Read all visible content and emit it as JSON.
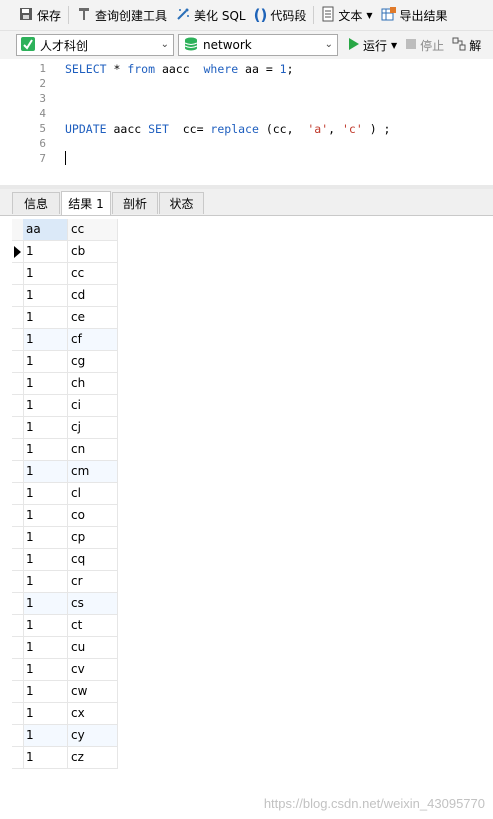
{
  "toolbar": {
    "save_label": "保存",
    "query_builder_label": "查询创建工具",
    "beautify_label": "美化 SQL",
    "snippet_label": "代码段",
    "text_label": "文本",
    "export_label": "导出结果"
  },
  "toolbar2": {
    "connection_value": "人才科创",
    "database_value": "network",
    "run_label": "运行",
    "stop_label": "停止",
    "explain_label": "解"
  },
  "editor": {
    "line_numbers": [
      "1",
      "2",
      "3",
      "4",
      "5",
      "6",
      "7"
    ],
    "line1": {
      "kw1": "SELECT",
      "t1": " * ",
      "kw2": "from",
      "t2": " aacc  ",
      "kw3": "where",
      "t3": " aa = ",
      "n1": "1",
      "t4": ";"
    },
    "line5": {
      "kw1": "UPDATE",
      "t1": " aacc ",
      "kw2": "SET",
      "t2": "  cc= ",
      "kw3": "replace",
      "t3": " (cc,  ",
      "s1": "'a'",
      "t4": ", ",
      "s2": "'c'",
      "t5": " ) ;"
    }
  },
  "tabs": {
    "info": "信息",
    "result": "结果 1",
    "profile": "剖析",
    "status": "状态"
  },
  "grid": {
    "columns": [
      "aa",
      "cc"
    ],
    "rows": [
      [
        "1",
        "cb"
      ],
      [
        "1",
        "cc"
      ],
      [
        "1",
        "cd"
      ],
      [
        "1",
        "ce"
      ],
      [
        "1",
        "cf"
      ],
      [
        "1",
        "cg"
      ],
      [
        "1",
        "ch"
      ],
      [
        "1",
        "ci"
      ],
      [
        "1",
        "cj"
      ],
      [
        "1",
        "cn"
      ],
      [
        "1",
        "cm"
      ],
      [
        "1",
        "cl"
      ],
      [
        "1",
        "co"
      ],
      [
        "1",
        "cp"
      ],
      [
        "1",
        "cq"
      ],
      [
        "1",
        "cr"
      ],
      [
        "1",
        "cs"
      ],
      [
        "1",
        "ct"
      ],
      [
        "1",
        "cu"
      ],
      [
        "1",
        "cv"
      ],
      [
        "1",
        "cw"
      ],
      [
        "1",
        "cx"
      ],
      [
        "1",
        "cy"
      ],
      [
        "1",
        "cz"
      ]
    ]
  },
  "watermark": "https://blog.csdn.net/weixin_43095770"
}
